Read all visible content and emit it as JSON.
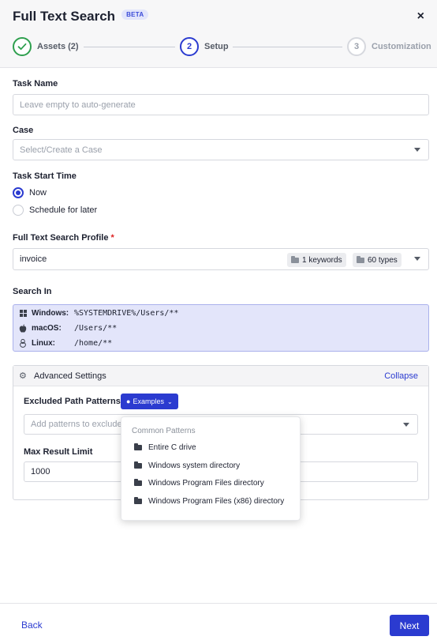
{
  "header": {
    "title": "Full Text Search",
    "badge": "BETA",
    "close_glyph": "×"
  },
  "steps": [
    {
      "number": "1",
      "label": "Assets (2)",
      "state": "complete",
      "icon": "check-icon"
    },
    {
      "number": "2",
      "label": "Setup",
      "state": "active"
    },
    {
      "number": "3",
      "label": "Customization",
      "state": "upcoming"
    }
  ],
  "form": {
    "task_name": {
      "label": "Task Name",
      "placeholder": "Leave empty to auto-generate",
      "value": ""
    },
    "case": {
      "label": "Case",
      "placeholder": "Select/Create a Case"
    },
    "start_time": {
      "label": "Task Start Time",
      "options": [
        {
          "label": "Now",
          "selected": true
        },
        {
          "label": "Schedule for later",
          "selected": false
        }
      ]
    },
    "profile": {
      "label": "Full Text Search Profile",
      "required_mark": "*",
      "value": "invoice",
      "tags": [
        "1 keywords",
        "60 types"
      ]
    },
    "search_in": {
      "label": "Search In",
      "rows": [
        {
          "os": "Windows:",
          "path": "%SYSTEMDRIVE%/Users/**",
          "icon": "windows-icon"
        },
        {
          "os": "macOS:",
          "path": "/Users/**",
          "icon": "apple-icon"
        },
        {
          "os": "Linux:",
          "path": "/home/**",
          "icon": "linux-icon"
        }
      ]
    }
  },
  "advanced": {
    "title": "Advanced Settings",
    "collapse_label": "Collapse",
    "excluded_label": "Excluded Path Patterns",
    "examples_label": "Examples",
    "excluded_placeholder": "Add patterns to exclude",
    "max_label": "Max Result Limit",
    "max_value": "1000"
  },
  "examples_menu": {
    "heading": "Common Patterns",
    "items": [
      "Entire C drive",
      "Windows system directory",
      "Windows Program Files directory",
      "Windows Program Files (x86) directory"
    ]
  },
  "footer": {
    "back_label": "Back",
    "next_label": "Next"
  },
  "colors": {
    "primary": "#2b3bd0",
    "success": "#2e9f4e",
    "search_in_bg": "#e3e5fa"
  }
}
